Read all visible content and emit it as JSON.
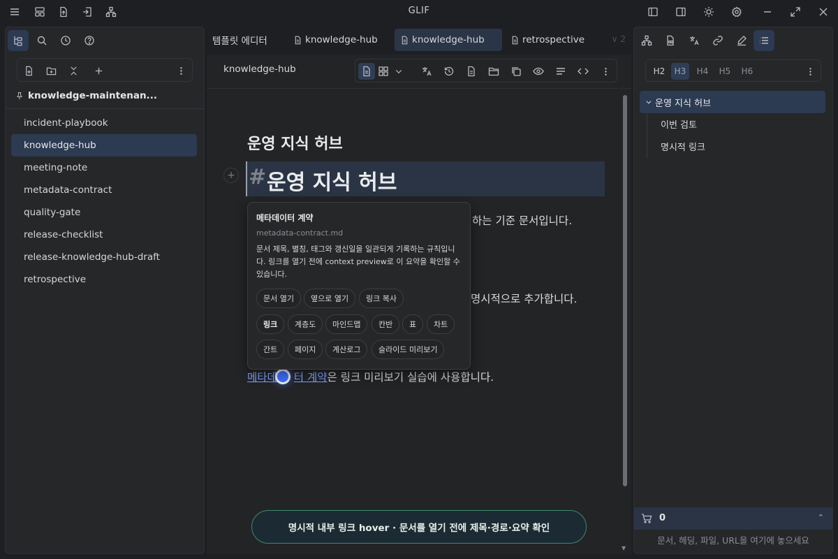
{
  "app": {
    "title": "GLIF"
  },
  "left": {
    "vault_title": "knowledge-maintenan...",
    "files": [
      "incident-playbook",
      "knowledge-hub",
      "meeting-note",
      "metadata-contract",
      "quality-gate",
      "release-checklist",
      "release-knowledge-hub-draft",
      "retrospective"
    ],
    "active_file": "knowledge-hub"
  },
  "tabs": {
    "items": [
      "템플릿 에디터",
      "knowledge-hub",
      "knowledge-hub",
      "retrospective"
    ],
    "overflow": "∨ 2"
  },
  "editor": {
    "title": "knowledge-hub",
    "h2": "운영 지식 허브",
    "h1_hash": "#",
    "h1_text": "운영 지식 허브",
    "para1_tail": "하는 기준 문서입니다.",
    "para2_tail": "명시적으로 추가합니다.",
    "link_part1": "메타데",
    "link_part2": "터 계약",
    "link_suffix": "은 링크 미리보기 실습에 사용합니다."
  },
  "popover": {
    "title": "메타데이터 계약",
    "path": "metadata-contract.md",
    "description": "문서 제목, 별칭, 태그와 갱신일을 일관되게 기록하는 규칙입니다. 링크를 열기 전에 context preview로 이 요약을 확인할 수 있습니다.",
    "actions": [
      "문서 열기",
      "옆으로 열기",
      "링크 복사"
    ],
    "views_row1": [
      "링크",
      "계층도",
      "마인드맵",
      "칸반",
      "표",
      "차트"
    ],
    "views_row2": [
      "간트",
      "페이지",
      "계산로그",
      "슬라이드 미리보기"
    ]
  },
  "status": {
    "message": "명시적 내부 링크 hover · 문서를 열기 전에 제목·경로·요약 확인"
  },
  "right": {
    "heading_levels": [
      "H2",
      "H3",
      "H4",
      "H5",
      "H6"
    ],
    "outline_root": "운영 지식 허브",
    "outline_children": [
      "이번 검토",
      "명시적 링크"
    ],
    "cart_count": "0",
    "drop_hint": "문서, 헤딩, 파일, URL을 여기에 놓으세요"
  },
  "colors": {
    "accent": "#2c3a52",
    "link": "#7fa4ff",
    "status_border": "#3d8a6b"
  }
}
